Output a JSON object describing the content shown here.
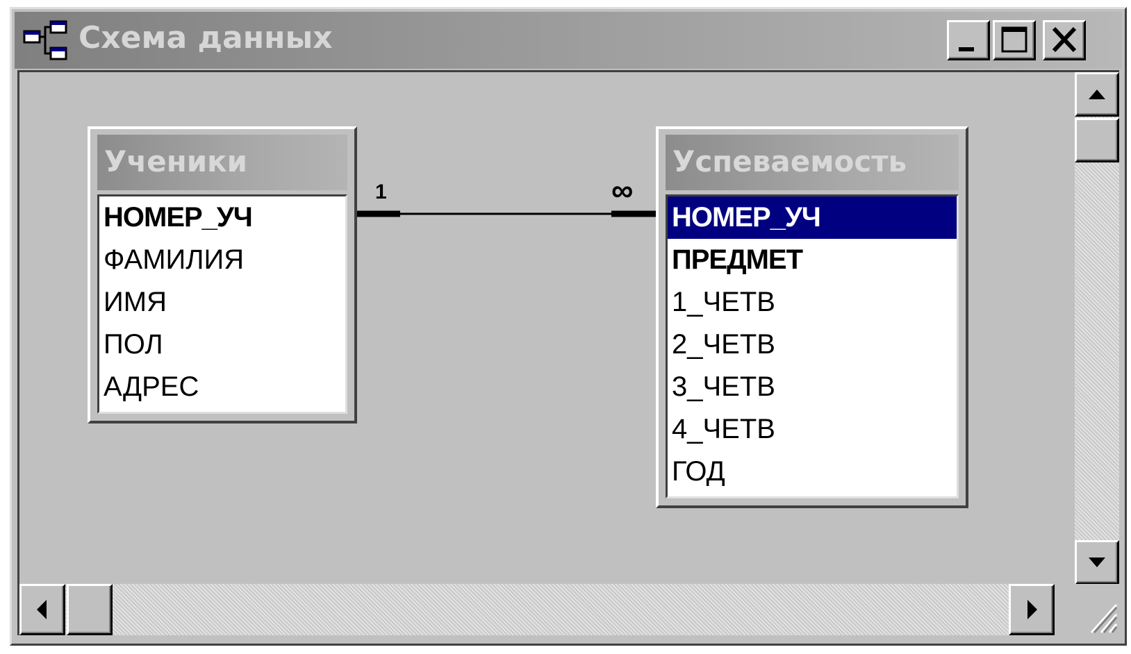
{
  "window": {
    "title": "Схема данных",
    "icon": "relationships-icon",
    "controls": {
      "minimize": "minimize-icon",
      "maximize": "maximize-icon",
      "close": "close-icon"
    }
  },
  "tables": [
    {
      "name": "Ученики",
      "fields": [
        {
          "label": "НОМЕР_УЧ",
          "key": true,
          "selected": false
        },
        {
          "label": "ФАМИЛИЯ",
          "key": false,
          "selected": false
        },
        {
          "label": "ИМЯ",
          "key": false,
          "selected": false
        },
        {
          "label": "ПОЛ",
          "key": false,
          "selected": false
        },
        {
          "label": "АДРЕС",
          "key": false,
          "selected": false
        }
      ]
    },
    {
      "name": "Успеваемость",
      "fields": [
        {
          "label": "НОМЕР_УЧ",
          "key": true,
          "selected": true
        },
        {
          "label": "ПРЕДМЕТ",
          "key": true,
          "selected": false
        },
        {
          "label": "1_ЧЕТВ",
          "key": false,
          "selected": false
        },
        {
          "label": "2_ЧЕТВ",
          "key": false,
          "selected": false
        },
        {
          "label": "3_ЧЕТВ",
          "key": false,
          "selected": false
        },
        {
          "label": "4_ЧЕТВ",
          "key": false,
          "selected": false
        },
        {
          "label": "ГОД",
          "key": false,
          "selected": false
        }
      ]
    }
  ],
  "relationship": {
    "one_side": "1",
    "many_side": "∞"
  },
  "colors": {
    "selection": "#000080",
    "face": "#c0c0c0"
  }
}
